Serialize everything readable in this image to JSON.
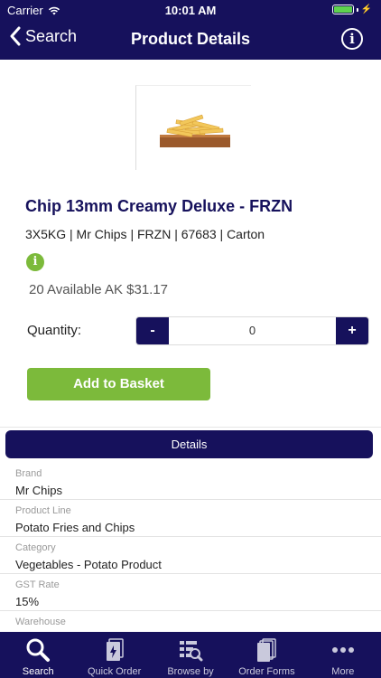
{
  "status_bar": {
    "carrier": "Carrier",
    "time": "10:01 AM"
  },
  "nav": {
    "back_label": "Search",
    "title": "Product Details"
  },
  "product": {
    "title": "Chip 13mm Creamy Deluxe - FRZN",
    "meta": "3X5KG  | Mr Chips | FRZN | 67683 | Carton",
    "availability": "20 Available AK $31.17"
  },
  "quantity": {
    "label": "Quantity:",
    "minus": "-",
    "value": "0",
    "plus": "+"
  },
  "add_button": "Add to Basket",
  "details": {
    "header": "Details",
    "rows": [
      {
        "label": "Brand",
        "value": "Mr Chips"
      },
      {
        "label": "Product Line",
        "value": "Potato Fries and Chips"
      },
      {
        "label": "Category",
        "value": "Vegetables - Potato Product"
      },
      {
        "label": "GST Rate",
        "value": "15%"
      },
      {
        "label": "Warehouse",
        "value": ""
      }
    ]
  },
  "tabs": [
    {
      "label": "Search",
      "icon": "search-icon",
      "active": true
    },
    {
      "label": "Quick Order",
      "icon": "quick-order-icon",
      "active": false
    },
    {
      "label": "Browse by",
      "icon": "browse-icon",
      "active": false
    },
    {
      "label": "Order Forms",
      "icon": "order-forms-icon",
      "active": false
    },
    {
      "label": "More",
      "icon": "more-icon",
      "active": false
    }
  ],
  "colors": {
    "navy": "#16115c",
    "green": "#7cba3b",
    "battery": "#5ed34e"
  }
}
